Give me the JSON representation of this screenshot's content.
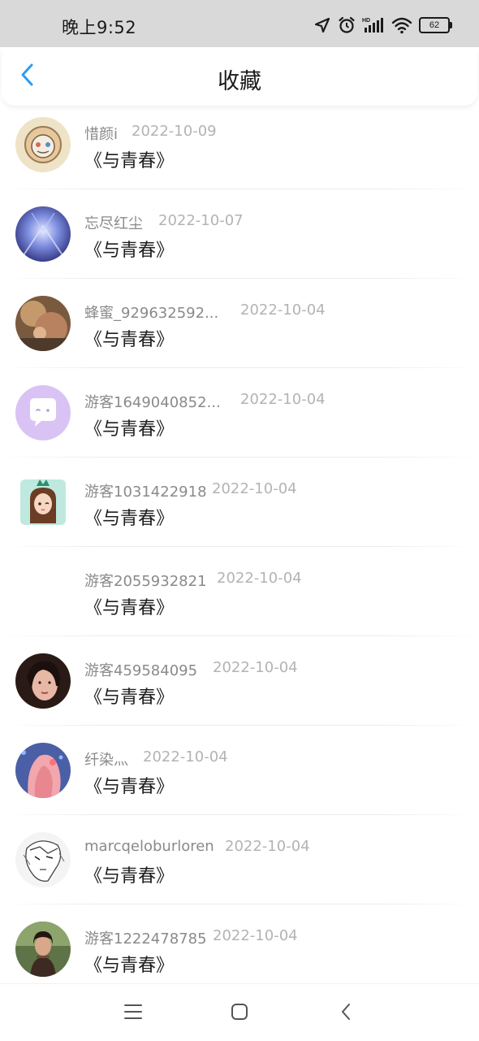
{
  "status_bar": {
    "time": "晚上9:52",
    "battery": "62",
    "icons": [
      "location-icon",
      "alarm-icon",
      "hd-signal-icon",
      "wifi-icon",
      "battery-icon"
    ]
  },
  "header": {
    "title": "收藏",
    "back_icon": "chevron-left-icon",
    "accent_color": "#2a9df4"
  },
  "items": [
    {
      "nickname": "惜颜i",
      "date": "2022-10-09",
      "title": "《与青春》",
      "avatar": "cartoon"
    },
    {
      "nickname": "忘尽红尘",
      "date": "2022-10-07",
      "title": "《与青春》",
      "avatar": "blue-light"
    },
    {
      "nickname": "蜂蜜_929632592...",
      "date": "2022-10-04",
      "title": "《与青春》",
      "avatar": "photo"
    },
    {
      "nickname": "游客1649040852...",
      "date": "2022-10-04",
      "title": "《与青春》",
      "avatar": "default-chat"
    },
    {
      "nickname": "游客1031422918",
      "date": "2022-10-04",
      "title": "《与青春》",
      "avatar": "anime-girl"
    },
    {
      "nickname": "游客2055932821",
      "date": "2022-10-04",
      "title": "《与青春》",
      "avatar": "none"
    },
    {
      "nickname": "游客459584095",
      "date": "2022-10-04",
      "title": "《与青春》",
      "avatar": "portrait"
    },
    {
      "nickname": "纤染灬",
      "date": "2022-10-04",
      "title": "《与青春》",
      "avatar": "pink-hair"
    },
    {
      "nickname": "marcqeloburloren",
      "date": "2022-10-04",
      "title": "《与青春》",
      "avatar": "sketch"
    },
    {
      "nickname": "游客1222478785",
      "date": "2022-10-04",
      "title": "《与青春》",
      "avatar": "photo-girl"
    }
  ],
  "nav_bar": {
    "icons": [
      "menu-icon",
      "home-icon",
      "back-icon"
    ]
  }
}
